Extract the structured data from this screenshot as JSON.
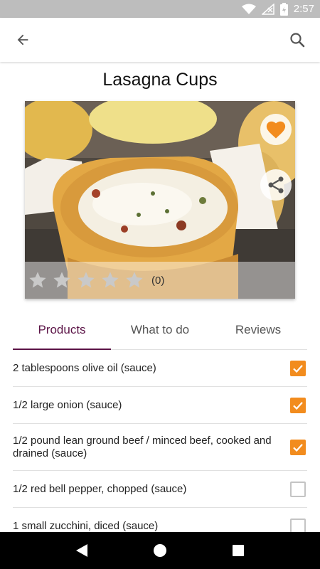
{
  "status_bar": {
    "time": "2:57"
  },
  "recipe": {
    "title": "Lasagna Cups",
    "rating_count": "(0)",
    "stars": 0,
    "favorite": true
  },
  "tabs": [
    {
      "label": "Products",
      "active": true
    },
    {
      "label": "What to do",
      "active": false
    },
    {
      "label": "Reviews",
      "active": false
    }
  ],
  "products": [
    {
      "text": "2 tablespoons olive oil (sauce)",
      "checked": true
    },
    {
      "text": "1/2 large onion (sauce)",
      "checked": true
    },
    {
      "text": "1/2 pound lean ground beef / minced beef, cooked and drained (sauce)",
      "checked": true
    },
    {
      "text": "1/2 red bell pepper, chopped (sauce)",
      "checked": false
    },
    {
      "text": "1 small zucchini, diced (sauce)",
      "checked": false
    }
  ],
  "colors": {
    "accent": "#f28c1e",
    "tab_active": "#5b1346"
  },
  "icons": {
    "back": "arrow-left-icon",
    "search": "search-icon",
    "favorite": "heart-icon",
    "share": "share-icon",
    "star": "star-icon",
    "nav_back": "triangle-back-icon",
    "nav_home": "circle-home-icon",
    "nav_recent": "square-recent-icon"
  }
}
